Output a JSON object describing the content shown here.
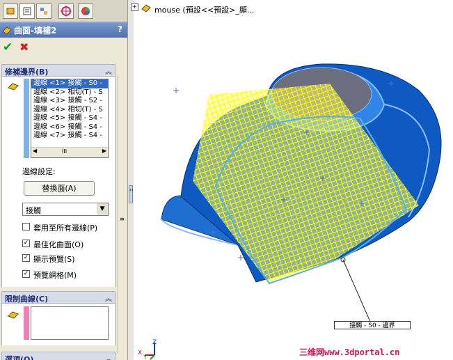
{
  "panel": {
    "tabs": [
      "feature-manager-icon",
      "property-manager-icon",
      "configuration-icon",
      "dimxpert-icon",
      "display-icon"
    ],
    "title": "曲面-填補2",
    "help": "?",
    "ok_symbol": "✔",
    "cancel_symbol": "✖",
    "boundary_section": {
      "title": "修補邊界(B)",
      "edges": [
        "邊線 <1> 接觸 - S0 -",
        "邊線 <2> 相切(T) - S",
        "邊線 <3> 接觸 - S2 -",
        "邊線 <4> 相切(T) - S",
        "邊線 <5> 接觸 - S4 -",
        "邊線 <6> 接觸 - S4 -",
        "邊線 <7> 接觸 - S4 -"
      ],
      "scroll_thumb": "III",
      "edge_settings_label": "邊線設定:",
      "swap_button": "替換面(A)",
      "curvature_value": "接觸",
      "options": [
        {
          "label": "套用至所有邊線(P)",
          "checked": false
        },
        {
          "label": "最佳化曲面(O)",
          "checked": true
        },
        {
          "label": "顯示預覽(S)",
          "checked": true
        },
        {
          "label": "預覽網格(M)",
          "checked": true
        }
      ]
    },
    "constraint_section": {
      "title": "限制曲線(C)"
    },
    "options_section": {
      "title": "選項(O)"
    }
  },
  "viewport": {
    "tree_label": "mouse (預設<<預設>_顯...",
    "callout": "接觸 - S0 - 邊界",
    "watermark": "三维网www.3dportal.cn",
    "triad": {
      "x": "X",
      "y": "Y",
      "z": "Z"
    }
  },
  "colors": {
    "panel_bg": "#ece9d8",
    "section_title": "#1f2f7a",
    "selection": "#316ac5",
    "model_blue": "#1f6fd0",
    "mesh_yellow": "#ffff00",
    "watermark": "#d4154c"
  }
}
